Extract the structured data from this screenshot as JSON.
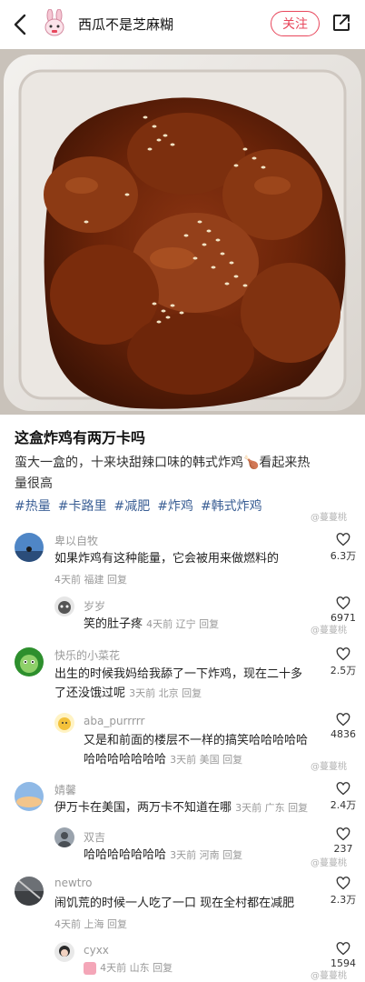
{
  "header": {
    "author": "西瓜不是芝麻糊",
    "follow_label": "关注"
  },
  "post": {
    "title": "这盒炸鸡有两万卡吗",
    "body_line1": "蛮大一盒的，十来块甜辣口味的韩式炸鸡🍗看起来热",
    "body_line2": "量很高",
    "tags": [
      "#热量",
      "#卡路里",
      "#减肥",
      "#炸鸡",
      "#韩式炸鸡"
    ]
  },
  "watermark": "@蔓蔓桃",
  "comments": [
    {
      "name": "卑以自牧",
      "text": "如果炸鸡有这种能量，它会被用来做燃料的",
      "meta": "4天前 福建 回复",
      "likes": "6.3万",
      "reply": {
        "name": "岁岁",
        "text": "笑的肚子疼",
        "meta": "4天前 辽宁 回复",
        "likes": "6971"
      }
    },
    {
      "name": "快乐的小菜花",
      "text1": "出生的时候我妈给我舔了一下炸鸡，现在二十多",
      "text2": "了还没饿过呢",
      "meta": "3天前 北京 回复",
      "likes": "2.5万",
      "reply": {
        "name": "aba_purrrrr",
        "text1": "又是和前面的楼层不一样的搞笑哈哈哈哈哈",
        "text2": "哈哈哈哈哈哈哈",
        "meta": "3天前 美国 回复",
        "likes": "4836"
      }
    },
    {
      "name": "婧馨",
      "text": "伊万卡在美国，两万卡不知道在哪",
      "meta": "3天前 广东 回复",
      "likes": "2.4万",
      "reply": {
        "name": "双吉",
        "text": "哈哈哈哈哈哈哈",
        "meta": "3天前 河南 回复",
        "likes": "237"
      }
    },
    {
      "name": "newtro",
      "text": "闹饥荒的时候一人吃了一口 现在全村都在减肥",
      "meta": "4天前 上海 回复",
      "likes": "2.3万",
      "reply": {
        "name": "cyxx",
        "meta": "4天前 山东 回复",
        "likes": "1594"
      }
    }
  ]
}
